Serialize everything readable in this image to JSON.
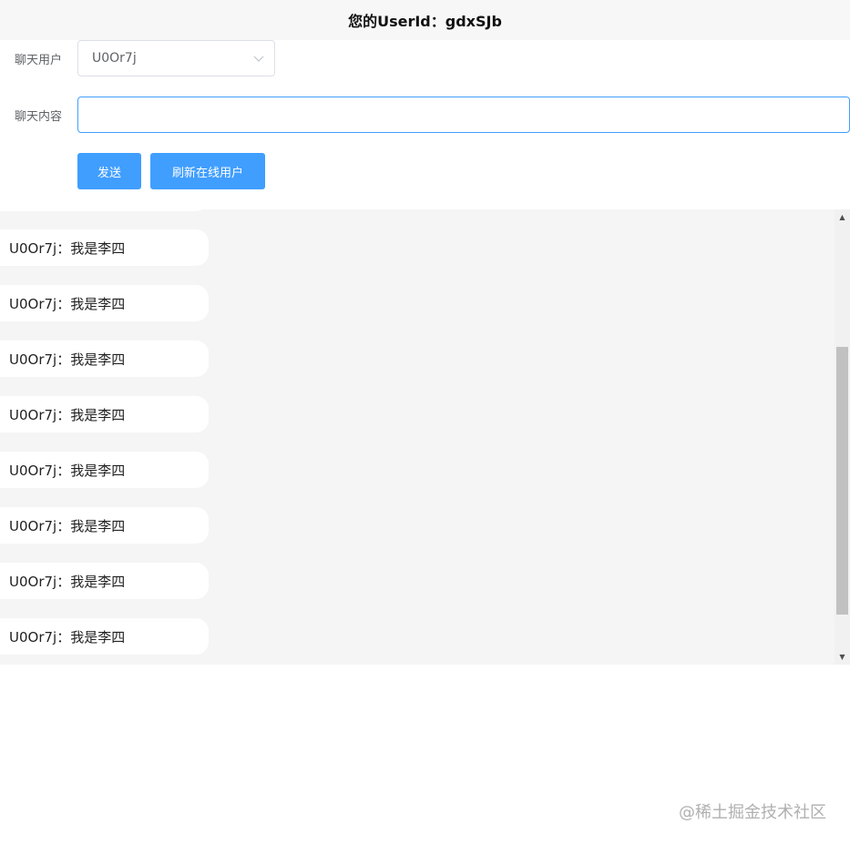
{
  "header": {
    "title": "您的UserId：gdxSJb"
  },
  "form": {
    "user_label": "聊天用户",
    "user_selected": "U0Or7j",
    "content_label": "聊天内容",
    "content_value": "",
    "send_button": "发送",
    "refresh_button": "刷新在线用户"
  },
  "messages": [
    "U0Or7j：我是李四",
    "U0Or7j：我是李四",
    "U0Or7j：我是李四",
    "U0Or7j：我是李四",
    "U0Or7j：我是李四",
    "U0Or7j：我是李四",
    "U0Or7j：我是李四",
    "U0Or7j：我是李四"
  ],
  "scroll_position": 0.78,
  "watermark": "@稀土掘金技术社区",
  "colors": {
    "primary": "#409eff",
    "chat_background": "#f5f5f5",
    "header_background": "#f7f7f7"
  }
}
